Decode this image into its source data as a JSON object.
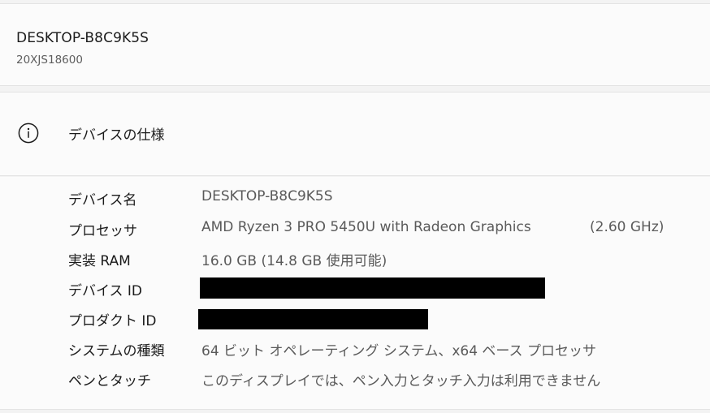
{
  "device": {
    "name": "DESKTOP-B8C9K5S",
    "model": "20XJS18600"
  },
  "spec_section": {
    "icon": "info-icon",
    "title": "デバイスの仕様"
  },
  "specs": [
    {
      "label": "デバイス名",
      "value": "DESKTOP-B8C9K5S"
    },
    {
      "label": "プロセッサ",
      "value": "AMD Ryzen 3 PRO 5450U with Radeon Graphics",
      "extra": "(2.60 GHz)"
    },
    {
      "label": "実装 RAM",
      "value": "16.0 GB (14.8 GB 使用可能)"
    },
    {
      "label": "デバイス ID",
      "value": ""
    },
    {
      "label": "プロダクト ID",
      "value": ""
    },
    {
      "label": "システムの種類",
      "value": "64 ビット オペレーティング システム、x64 ベース プロセッサ"
    },
    {
      "label": "ペンとタッチ",
      "value": "このディスプレイでは、ペン入力とタッチ入力は利用できません"
    }
  ]
}
